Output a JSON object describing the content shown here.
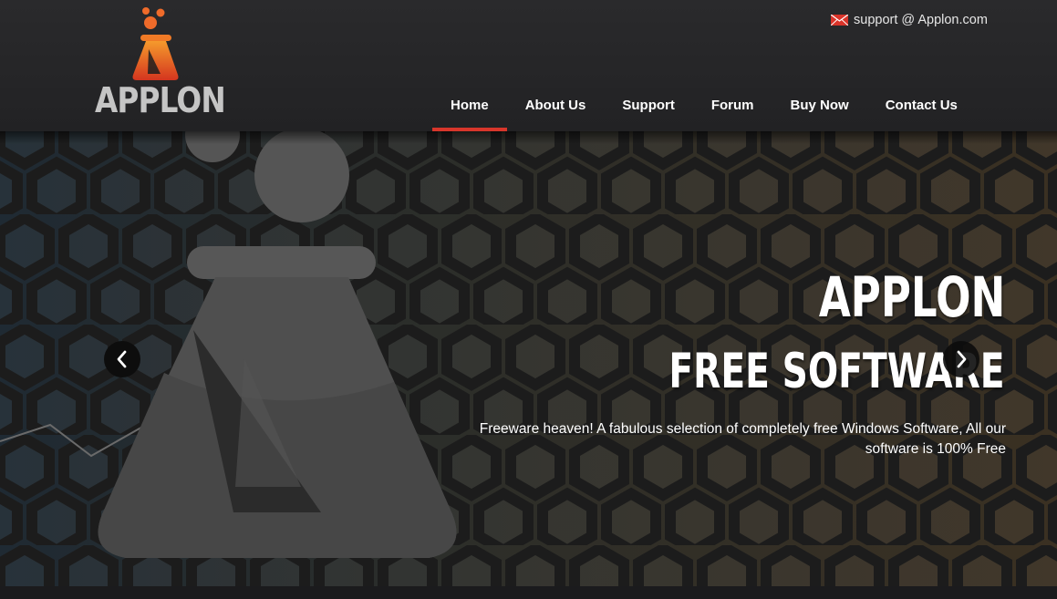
{
  "brand": {
    "name": "APPLON",
    "logo_icon": "flask-logo-icon"
  },
  "header": {
    "support_email": "support @ Applon.com",
    "support_icon": "mail-icon"
  },
  "nav": {
    "items": [
      {
        "label": "Home",
        "active": true
      },
      {
        "label": "About Us",
        "active": false
      },
      {
        "label": "Support",
        "active": false
      },
      {
        "label": "Forum",
        "active": false
      },
      {
        "label": "Buy Now",
        "active": false
      },
      {
        "label": "Contact Us",
        "active": false
      }
    ]
  },
  "hero": {
    "title": "APPLON",
    "subtitle": "FREE SOFTWARE",
    "description": "Freeware heaven! A fabulous selection of completely free Windows Software, All our software is 100% Free",
    "prev_icon": "chevron-left-icon",
    "next_icon": "chevron-right-icon"
  },
  "colors": {
    "accent": "#d8362b",
    "header_bg": "#262628",
    "logo_orange": "#f07a26"
  }
}
